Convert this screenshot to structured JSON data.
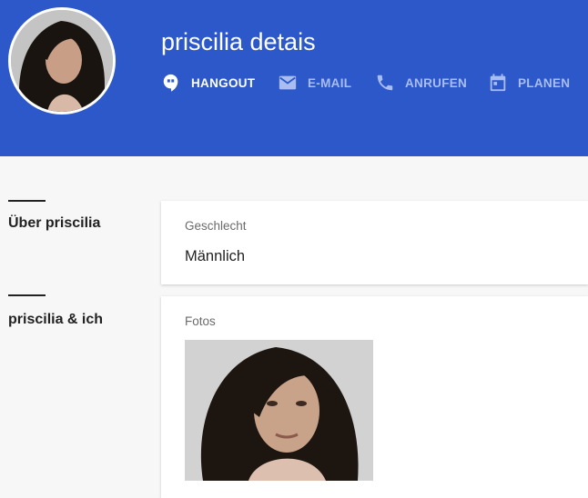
{
  "header": {
    "title": "priscilia detais",
    "accent_color": "#2c58c9",
    "actions": [
      {
        "label": "HANGOUT",
        "icon": "hangout-icon",
        "active": true
      },
      {
        "label": "E-MAIL",
        "icon": "mail-icon",
        "active": false
      },
      {
        "label": "ANRUFEN",
        "icon": "phone-icon",
        "active": false
      },
      {
        "label": "PLANEN",
        "icon": "calendar-icon",
        "active": false
      }
    ]
  },
  "sections": {
    "about": {
      "heading": "Über priscilia",
      "field_label": "Geschlecht",
      "field_value": "Männlich"
    },
    "you_and": {
      "heading": "priscilia & ich",
      "photos_label": "Fotos"
    }
  }
}
